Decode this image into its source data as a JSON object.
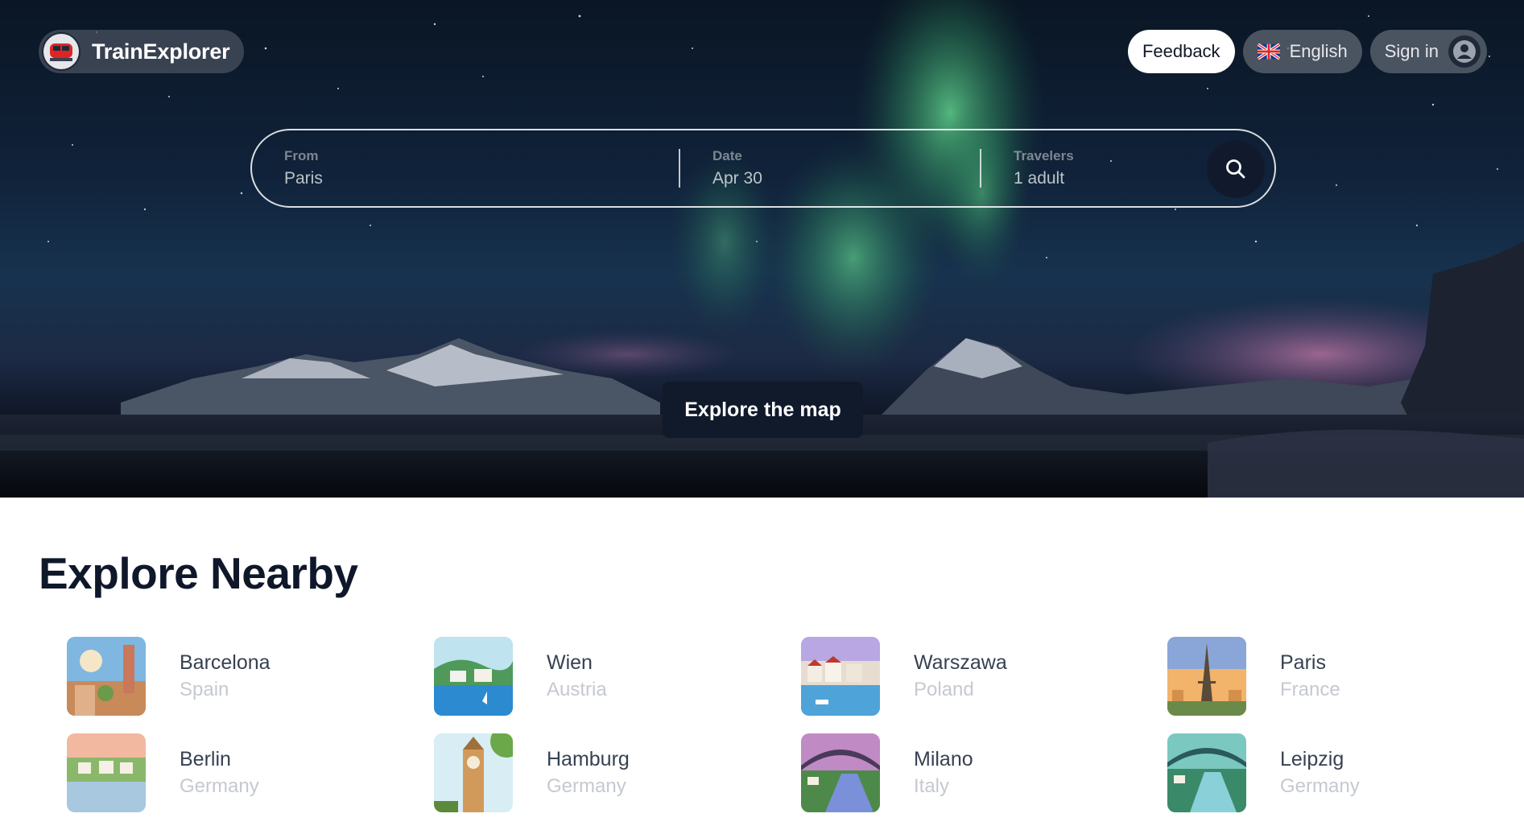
{
  "header": {
    "brand": "TrainExplorer",
    "feedback_label": "Feedback",
    "language_label": "English",
    "signin_label": "Sign in"
  },
  "search": {
    "from_label": "From",
    "from_value": "Paris",
    "date_label": "Date",
    "date_value": "Apr 30",
    "travelers_label": "Travelers",
    "travelers_value": "1 adult"
  },
  "hero": {
    "explore_map_label": "Explore the map"
  },
  "nearby": {
    "title": "Explore Nearby",
    "destinations": [
      {
        "city": "Barcelona",
        "country": "Spain"
      },
      {
        "city": "Wien",
        "country": "Austria"
      },
      {
        "city": "Warszawa",
        "country": "Poland"
      },
      {
        "city": "Paris",
        "country": "France"
      },
      {
        "city": "Berlin",
        "country": "Germany"
      },
      {
        "city": "Hamburg",
        "country": "Germany"
      },
      {
        "city": "Milano",
        "country": "Italy"
      },
      {
        "city": "Leipzig",
        "country": "Germany"
      }
    ]
  }
}
